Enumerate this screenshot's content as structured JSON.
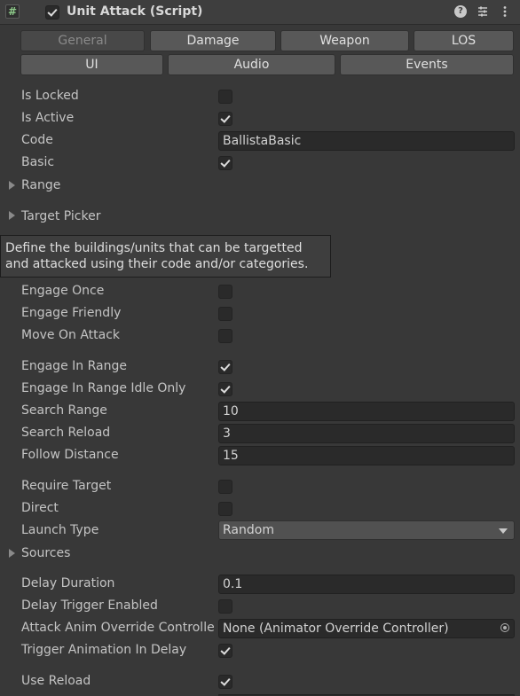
{
  "header": {
    "component_enabled": true,
    "title": "Unit Attack (Script)",
    "icons": [
      "script-icon",
      "help-icon",
      "preset-icon",
      "context-menu-icon"
    ]
  },
  "tabs": {
    "row1": [
      "General",
      "Damage",
      "Weapon",
      "LOS"
    ],
    "row2": [
      "UI",
      "Audio",
      "Events"
    ],
    "selected": "General"
  },
  "fields": {
    "is_locked": {
      "label": "Is Locked",
      "checked": false
    },
    "is_active": {
      "label": "Is Active",
      "checked": true
    },
    "code": {
      "label": "Code",
      "value": "BallistaBasic"
    },
    "basic": {
      "label": "Basic",
      "checked": true
    },
    "range": {
      "label": "Range"
    },
    "target_picker": {
      "label": "Target Picker"
    },
    "engage_once": {
      "label": "Engage Once",
      "checked": false
    },
    "engage_friendly": {
      "label": "Engage Friendly",
      "checked": false
    },
    "move_on_attack": {
      "label": "Move On Attack",
      "checked": false
    },
    "engage_in_range": {
      "label": "Engage In Range",
      "checked": true
    },
    "engage_in_range_idle_only": {
      "label": "Engage In Range Idle Only",
      "checked": true
    },
    "search_range": {
      "label": "Search Range",
      "value": "10"
    },
    "search_reload": {
      "label": "Search Reload",
      "value": "3"
    },
    "follow_distance": {
      "label": "Follow Distance",
      "value": "15"
    },
    "require_target": {
      "label": "Require Target",
      "checked": false
    },
    "direct": {
      "label": "Direct",
      "checked": false
    },
    "launch_type": {
      "label": "Launch Type",
      "value": "Random"
    },
    "sources": {
      "label": "Sources"
    },
    "delay_duration": {
      "label": "Delay Duration",
      "value": "0.1"
    },
    "delay_trigger_enabled": {
      "label": "Delay Trigger Enabled",
      "checked": false
    },
    "attack_anim_override_controller": {
      "label": "Attack Anim Override Controlle",
      "value": "None (Animator Override Controller)"
    },
    "trigger_animation_in_delay": {
      "label": "Trigger Animation In Delay",
      "checked": true
    },
    "use_reload": {
      "label": "Use Reload",
      "checked": true
    }
  },
  "tooltip": {
    "line1": "Define the buildings/units that can be targetted",
    "line2": "and attacked using their code and/or categories."
  }
}
